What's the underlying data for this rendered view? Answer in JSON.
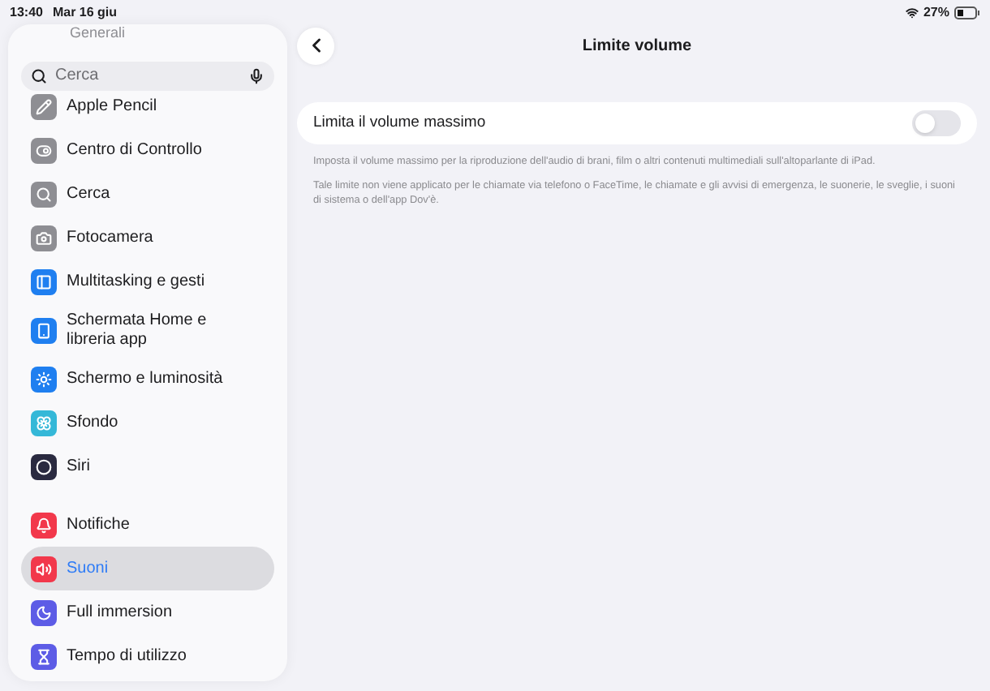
{
  "status_bar": {
    "time": "13:40",
    "date": "Mar 16 giu",
    "battery": "27%"
  },
  "sidebar": {
    "faded_item": "Generali",
    "search": {
      "placeholder": "Cerca"
    },
    "groups": [
      [
        {
          "label": "Apple Pencil",
          "color": "#8e8e93",
          "selected": false
        },
        {
          "label": "Centro di Controllo",
          "color": "#8e8e93",
          "selected": false
        },
        {
          "label": "Cerca",
          "color": "#8e8e93",
          "selected": false
        },
        {
          "label": "Fotocamera",
          "color": "#8e8e93",
          "selected": false
        },
        {
          "label": "Multitasking e gesti",
          "color": "#1f7ff0",
          "selected": false
        },
        {
          "label": "Schermata Home e libreria app",
          "color": "#1f7ff0",
          "selected": false
        },
        {
          "label": "Schermo e luminosità",
          "color": "#1f7ff0",
          "selected": false
        },
        {
          "label": "Sfondo",
          "color": "#35b8d8",
          "selected": false
        },
        {
          "label": "Siri",
          "color": "#2a2a40",
          "selected": false
        }
      ],
      [
        {
          "label": "Notifiche",
          "color": "#f2384b",
          "selected": false
        },
        {
          "label": "Suoni",
          "color": "#f2384b",
          "selected": true
        },
        {
          "label": "Full immersion",
          "color": "#5d5ce6",
          "selected": false
        },
        {
          "label": "Tempo di utilizzo",
          "color": "#5d5ce6",
          "selected": false
        }
      ]
    ]
  },
  "detail": {
    "title": "Limite volume",
    "setting": {
      "label": "Limita il volume massimo",
      "on": false
    },
    "notes": [
      "Imposta il volume massimo per la riproduzione dell'audio di brani, film o altri contenuti multimediali sull'altoparlante di iPad.",
      "Tale limite non viene applicato per le chiamate via telefono o FaceTime, le chiamate e gli avvisi di emergenza, le suonerie, le sveglie, i suoni di sistema o dell'app Dov'è."
    ]
  }
}
